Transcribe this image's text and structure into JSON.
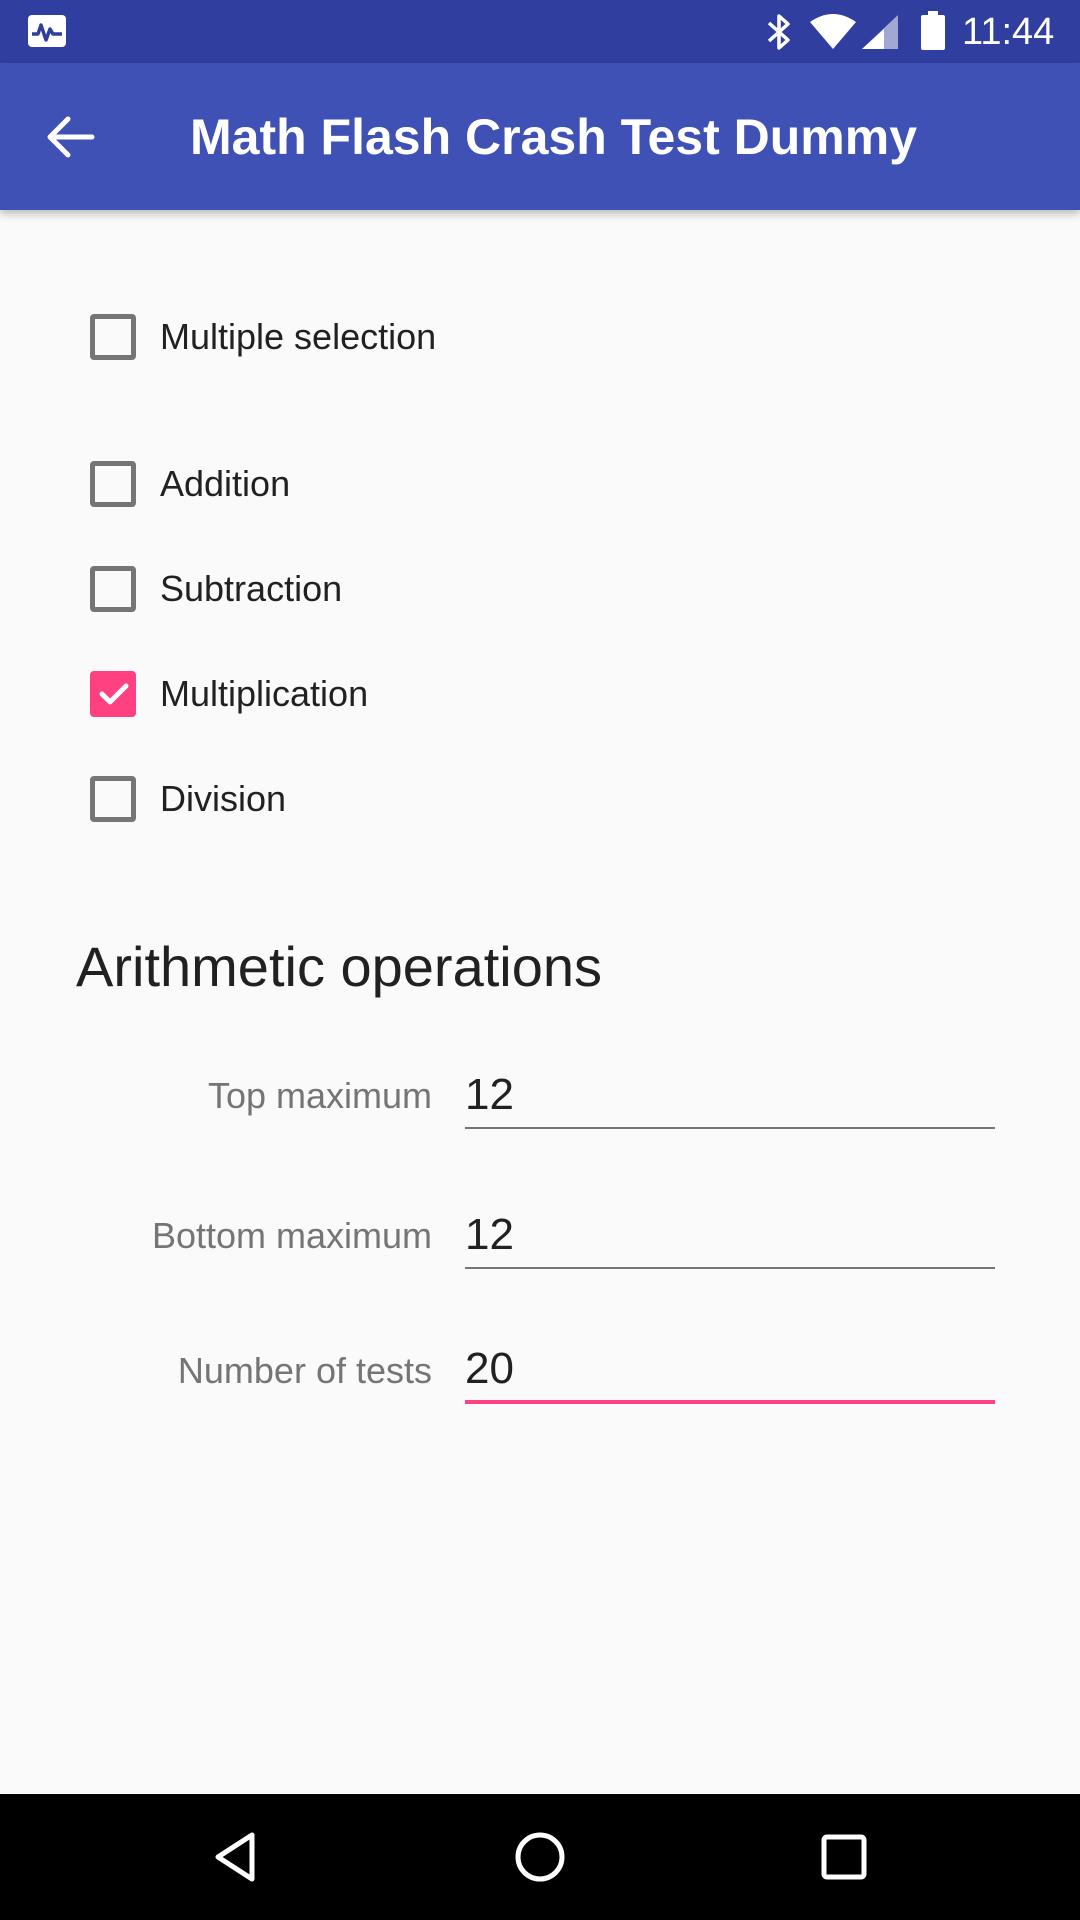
{
  "status_bar": {
    "time": "11:44",
    "icons": [
      "activity-monitor-icon",
      "bluetooth-icon",
      "wifi-icon",
      "cell-signal-icon",
      "battery-icon"
    ]
  },
  "app_bar": {
    "title": "Math Flash Crash Test Dummy",
    "back_icon": "arrow-back-icon"
  },
  "options": {
    "multiple_selection": {
      "label": "Multiple selection",
      "checked": false
    },
    "operations": [
      {
        "label": "Addition",
        "checked": false
      },
      {
        "label": "Subtraction",
        "checked": false
      },
      {
        "label": "Multiplication",
        "checked": true
      },
      {
        "label": "Division",
        "checked": false
      }
    ]
  },
  "section": {
    "title": "Arithmetic operations"
  },
  "fields": {
    "top_maximum": {
      "label": "Top maximum",
      "value": "12"
    },
    "bottom_maximum": {
      "label": "Bottom maximum",
      "value": "12"
    },
    "number_of_tests": {
      "label": "Number of tests",
      "value": "20",
      "focused": true
    }
  },
  "colors": {
    "status_bar": "#303f9f",
    "app_bar": "#3f51b5",
    "accent": "#ff4081",
    "background": "#fafafa"
  },
  "nav_bar": {
    "icons": [
      "back-triangle-icon",
      "home-circle-icon",
      "recents-square-icon"
    ]
  }
}
